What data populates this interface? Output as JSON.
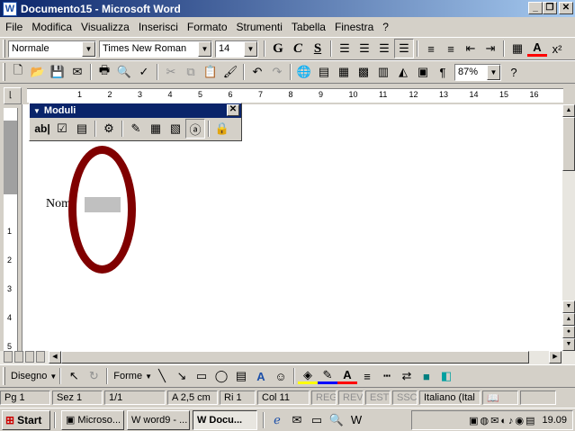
{
  "window": {
    "title": "Documento15 - Microsoft Word",
    "minimize": "_",
    "restore": "❐",
    "close": "✕"
  },
  "menu": [
    "File",
    "Modifica",
    "Visualizza",
    "Inserisci",
    "Formato",
    "Strumenti",
    "Tabella",
    "Finestra",
    "?"
  ],
  "formatting": {
    "style": "Normale",
    "font": "Times New Roman",
    "size": "14",
    "bold": "G",
    "italic": "C",
    "underline": "S"
  },
  "standard": {
    "zoom": "87%"
  },
  "ruler_numbers": [
    "1",
    "2",
    "3",
    "4",
    "5",
    "6",
    "7",
    "8",
    "9",
    "10",
    "11",
    "12",
    "13",
    "14",
    "15",
    "16"
  ],
  "moduli_toolbar": {
    "title": "Moduli",
    "textfield_label": "ab|"
  },
  "document": {
    "label_text": "Nome",
    "oval_color": "#800000"
  },
  "draw_toolbar": {
    "disegno": "Disegno",
    "forme": "Forme"
  },
  "status": {
    "page": "Pg 1",
    "section": "Sez 1",
    "pages": "1/1",
    "position": "A 2,5 cm",
    "line": "Ri 1",
    "col": "Col 11",
    "reg": "REG",
    "rev": "REV",
    "est": "EST",
    "ssc": "SSC",
    "language": "Italiano (Ital"
  },
  "taskbar": {
    "start": "Start",
    "tasks": [
      "Microso...",
      "word9 - ...",
      "Docu..."
    ],
    "clock": "19.09"
  },
  "colors": {
    "title_start": "#0a246a",
    "title_end": "#a6caf0",
    "chrome": "#d4d0c8"
  }
}
